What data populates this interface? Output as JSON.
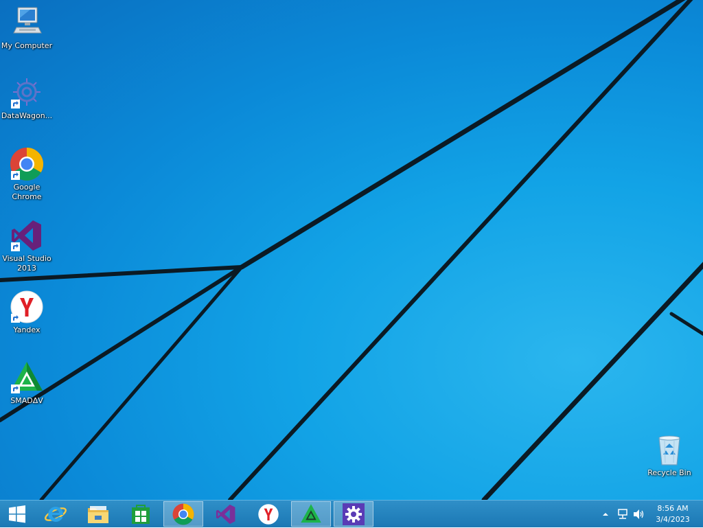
{
  "desktop": {
    "icons": [
      {
        "name": "my-computer",
        "label": "My Computer"
      },
      {
        "name": "datawagon",
        "label": "DataWagon..."
      },
      {
        "name": "google-chrome",
        "label": "Google\nChrome"
      },
      {
        "name": "visual-studio",
        "label": "Visual Studio\n2013"
      },
      {
        "name": "yandex",
        "label": "Yandex"
      },
      {
        "name": "smadav",
        "label": "SMADΔV"
      },
      {
        "name": "recycle-bin",
        "label": "Recycle Bin"
      }
    ]
  },
  "taskbar": {
    "buttons": [
      {
        "name": "start",
        "icon": "windows-logo-icon"
      },
      {
        "name": "internet-explorer",
        "icon": "internet-explorer-icon"
      },
      {
        "name": "file-explorer",
        "icon": "folder-icon"
      },
      {
        "name": "store",
        "icon": "store-icon"
      },
      {
        "name": "chrome",
        "icon": "chrome-icon",
        "active": true
      },
      {
        "name": "visual-studio",
        "icon": "visual-studio-icon"
      },
      {
        "name": "yandex",
        "icon": "yandex-icon"
      },
      {
        "name": "smadav",
        "icon": "smadav-icon",
        "active": true
      },
      {
        "name": "settings-app",
        "icon": "gear-icon",
        "active": true
      }
    ],
    "tray": {
      "time": "8:56 AM",
      "date": "3/4/2023"
    }
  },
  "colors": {
    "wallpaper": "#12a3e6",
    "taskbar": "#1f7fbb",
    "wallpaper_lines": "#0b1a24"
  }
}
